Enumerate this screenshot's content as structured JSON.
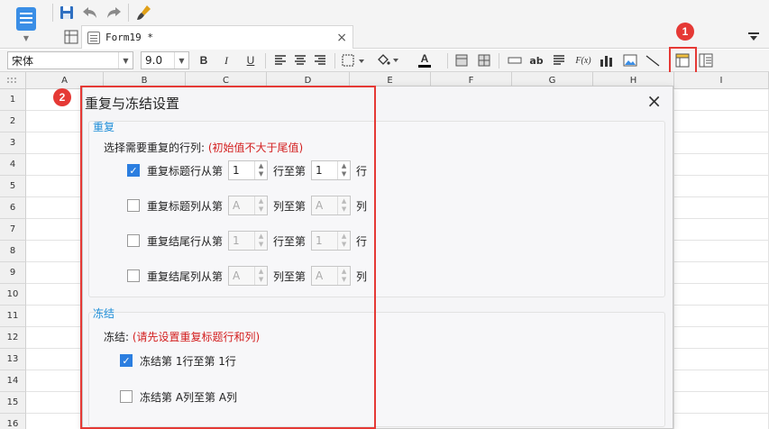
{
  "header": {
    "tab_title": "Form19 *",
    "tab_close": "×",
    "dropdown_glyph": "▼"
  },
  "toolbar": {
    "font_name": "宋体",
    "font_size": "9.0",
    "bold": "B",
    "italic": "I",
    "underline": "U",
    "text_label": "ab",
    "formula_label": "F(x)",
    "font_color_label": "A"
  },
  "markers": {
    "m1": "1",
    "m2": "2"
  },
  "grid": {
    "columns": [
      "A",
      "B",
      "C",
      "D",
      "E",
      "F",
      "G",
      "H",
      "I"
    ],
    "rows": [
      "1",
      "2",
      "3",
      "4",
      "5",
      "6",
      "7",
      "8",
      "9",
      "10",
      "11",
      "12",
      "13",
      "14",
      "15",
      "16"
    ]
  },
  "dialog": {
    "title": "重复与冻结设置",
    "close": "×",
    "repeat": {
      "title": "重复",
      "instruction": "选择需要重复的行列:",
      "warning": "(初始值不大于尾值)",
      "options": [
        {
          "label": "重复标题行从第",
          "checked": true,
          "from": "1",
          "mid": "行至第",
          "to": "1",
          "unit": "行",
          "disabled": false
        },
        {
          "label": "重复标题列从第",
          "checked": false,
          "from": "A",
          "mid": "列至第",
          "to": "A",
          "unit": "列",
          "disabled": true
        },
        {
          "label": "重复结尾行从第",
          "checked": false,
          "from": "1",
          "mid": "行至第",
          "to": "1",
          "unit": "行",
          "disabled": true
        },
        {
          "label": "重复结尾列从第",
          "checked": false,
          "from": "A",
          "mid": "列至第",
          "to": "A",
          "unit": "列",
          "disabled": true
        }
      ]
    },
    "freeze": {
      "title": "冻结",
      "instruction": "冻结:",
      "warning": "(请先设置重复标题行和列)",
      "options": [
        {
          "label": "冻结第 1行至第 1行",
          "checked": true
        },
        {
          "label": "冻结第 A列至第 A列",
          "checked": false
        }
      ]
    }
  },
  "colors": {
    "highlight": "#e53935",
    "accent": "#1f8ed8",
    "warning": "#d31f1f",
    "checkbox": "#2b7ee0"
  }
}
